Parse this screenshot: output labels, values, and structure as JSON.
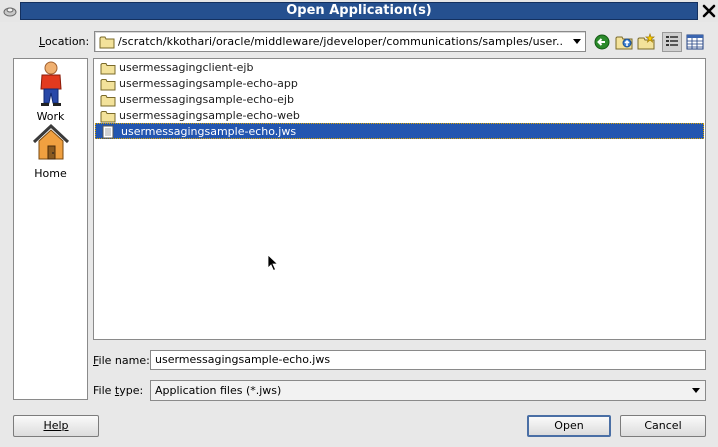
{
  "window": {
    "title": "Open Application(s)",
    "close_glyph": "✕"
  },
  "location": {
    "label_mnemonic": "L",
    "label_rest": "ocation:",
    "path": "/scratch/kkothari/oracle/middleware/jdeveloper/communications/samples/user..."
  },
  "toolbar": {
    "buttons": [
      "back-icon",
      "up-folder-icon",
      "new-folder-icon",
      "list-view-icon",
      "details-view-icon"
    ]
  },
  "places": [
    {
      "label": "Work",
      "icon": "work-person-icon"
    },
    {
      "label": "Home",
      "icon": "home-icon"
    }
  ],
  "files": [
    {
      "name": "usermessagingclient-ejb",
      "type": "folder"
    },
    {
      "name": "usermessagingsample-echo-app",
      "type": "folder"
    },
    {
      "name": "usermessagingsample-echo-ejb",
      "type": "folder"
    },
    {
      "name": "usermessagingsample-echo-web",
      "type": "folder"
    },
    {
      "name": "usermessagingsample-echo.jws",
      "type": "file",
      "selected": true
    }
  ],
  "file_name": {
    "label_mnemonic": "F",
    "label_rest": "ile name:",
    "value": "usermessagingsample-echo.jws"
  },
  "file_type": {
    "label_start": "File ",
    "label_mnemonic": "t",
    "label_rest": "ype:",
    "value": "Application files (*.jws)"
  },
  "buttons": {
    "help": "Help",
    "open": "Open",
    "cancel": "Cancel"
  },
  "colors": {
    "titlebar": "#25508f",
    "selection": "#2356b0"
  }
}
